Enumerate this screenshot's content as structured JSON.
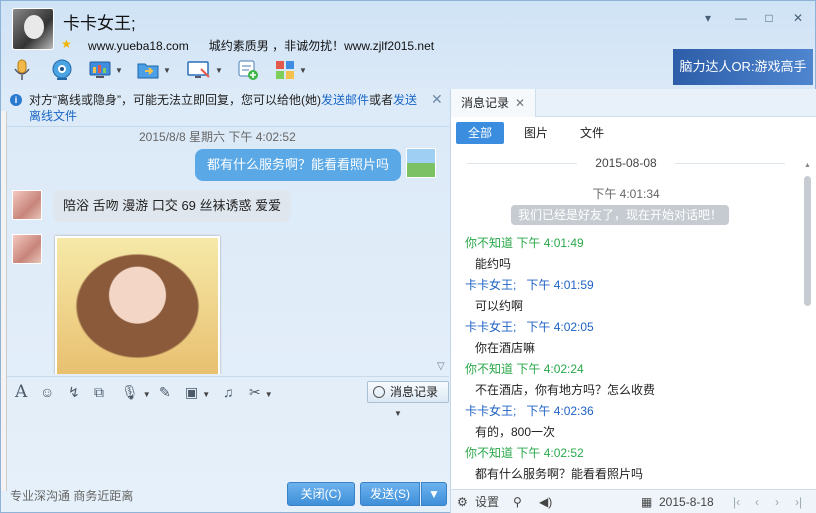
{
  "window": {
    "title": "卡卡女王;",
    "website": "www.yueba18.com",
    "signature": "城约素质男 ，非诚勿扰！www.zjlf2015.net",
    "controls": [
      "menu-icon",
      "minimize-icon",
      "maximize-icon",
      "close-icon"
    ],
    "banner": "脑力达人OR:游戏高手"
  },
  "toolbar": {
    "icons": [
      "voice-call-icon",
      "video-call-icon",
      "remote-desktop-icon",
      "file-transfer-icon",
      "screen-share-icon",
      "add-contact-icon",
      "apps-icon"
    ]
  },
  "notice": {
    "prefix": "对方“离线或隐身”，可能无法立即回复，您可以给他(她)",
    "link1": "发送邮件",
    "middle": "或者",
    "link2": "发送离线文件"
  },
  "chat": {
    "timestamp": "2015/8/8 星期六 下午 4:02:52",
    "outgoing": "都有什么服务啊？能看看照片吗",
    "incoming": "陪浴 舌吻 漫游 口交 69 丝袜诱惑 爱爱"
  },
  "editbar": {
    "icons": [
      "font-icon",
      "emoji-icon",
      "shake-icon",
      "screenshot-icon",
      "voice-icon",
      "edit-icon",
      "image-icon",
      "music-icon",
      "scissors-icon"
    ],
    "history_button": "消息记录"
  },
  "footer": {
    "slogan": "专业深沟通 商务近距离",
    "close_button": "关闭(C)",
    "send_button": "发送(S)"
  },
  "history": {
    "tab_label": "消息记录",
    "filters": [
      "全部",
      "图片",
      "文件"
    ],
    "date": "2015-08-08",
    "time": "下午 4:01:34",
    "system_message": "我们已经是好友了，现在开始对话吧！",
    "messages": [
      {
        "sender": "你不知道",
        "time": "下午 4:01:49",
        "text": "能约吗",
        "side": "me"
      },
      {
        "sender": "卡卡女王;",
        "time": "下午 4:01:59",
        "text": "可以约啊",
        "side": "them"
      },
      {
        "sender": "卡卡女王;",
        "time": "下午 4:02:05",
        "text": "你在酒店嘛",
        "side": "them"
      },
      {
        "sender": "你不知道",
        "time": "下午 4:02:24",
        "text": "不在酒店，你有地方吗？怎么收费",
        "side": "me"
      },
      {
        "sender": "卡卡女王;",
        "time": "下午 4:02:36",
        "text": "有的，800一次",
        "side": "them"
      },
      {
        "sender": "你不知道",
        "time": "下午 4:02:52",
        "text": "都有什么服务啊？能看看照片吗",
        "side": "me"
      }
    ],
    "settings_label": "设置",
    "footer_date": "2015-8-18"
  }
}
